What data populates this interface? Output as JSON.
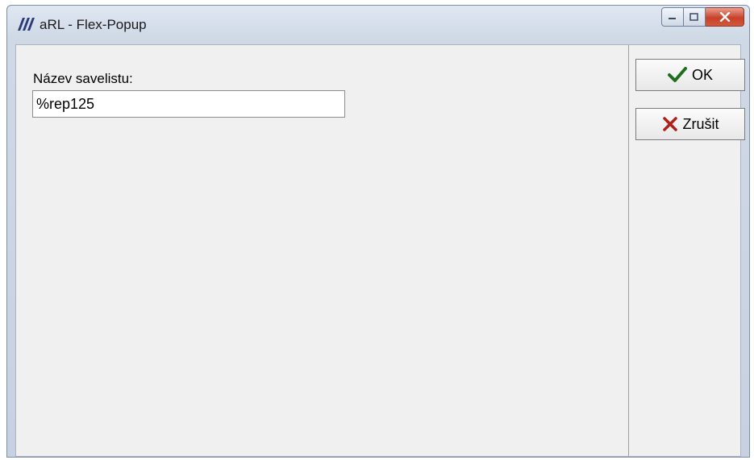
{
  "window": {
    "title": "aRL - Flex-Popup"
  },
  "form": {
    "label": "Název savelistu:",
    "input_value": "%rep125"
  },
  "buttons": {
    "ok_label": "OK",
    "cancel_label": "Zrušit"
  },
  "icons": {
    "ok": "checkmark-icon",
    "cancel": "x-icon",
    "app": "arl-logo-icon"
  },
  "colors": {
    "ok_icon": "#1f6e1f",
    "cancel_icon": "#b0201a",
    "close_button": "#c8412a"
  }
}
